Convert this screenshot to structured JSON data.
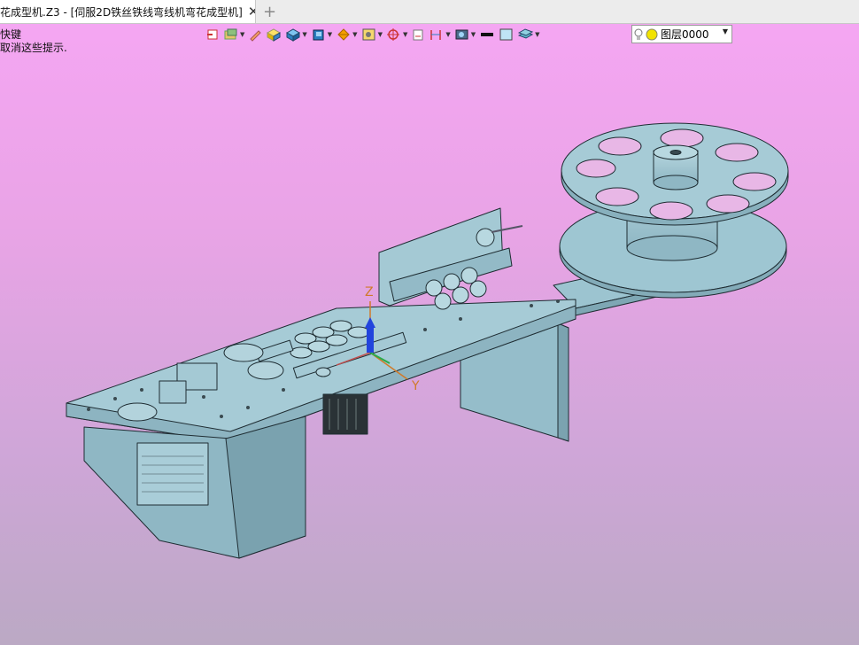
{
  "window": {
    "tab_title": "花成型机.Z3 - [伺服2D铁丝铁线弯线机弯花成型机]",
    "tab_close": "✕",
    "tab_add": "+"
  },
  "hint": {
    "line1": "快键",
    "line2": "取消这些提示."
  },
  "toolbar": {
    "icons": [
      "undo-icon",
      "layers-icon",
      "pencil-icon",
      "solid-icon",
      "box-icon",
      "shaded-icon",
      "section-icon",
      "view-icon",
      "snap-icon",
      "sketch-icon",
      "dimension-icon",
      "render-icon",
      "line-color-icon",
      "face-color-icon",
      "plane-icon"
    ],
    "layer_label": "图层0000",
    "colors": {
      "line": "#111111",
      "face": "#bfe4f6"
    }
  },
  "scene": {
    "axis_z": "Z",
    "axis_y": "Y",
    "background_top": "#f6a6f4",
    "background_bottom": "#bba9c4",
    "model_color": "#9cc4d0"
  }
}
